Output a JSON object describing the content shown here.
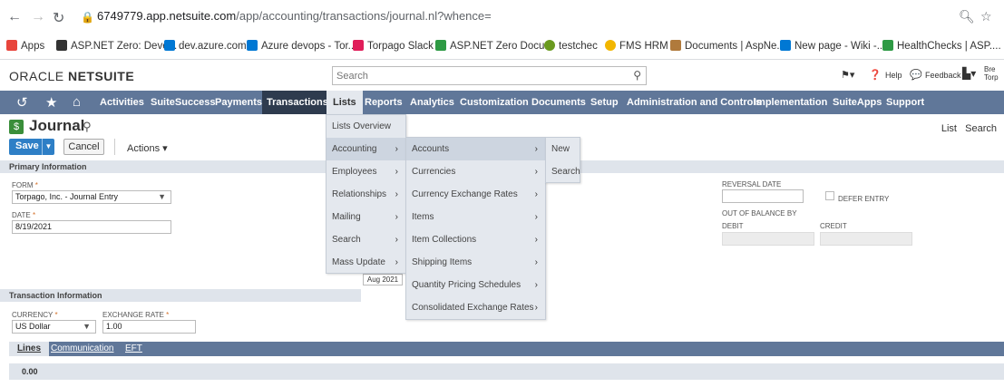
{
  "browser": {
    "url_host": "6749779.app.netsuite.com",
    "url_path": "/app/accounting/transactions/journal.nl?whence="
  },
  "bookmarks": [
    {
      "label": "Apps",
      "color": "#e8453c"
    },
    {
      "label": "ASP.NET Zero: Deve...",
      "color": "#333333"
    },
    {
      "label": "dev.azure.com",
      "color": "#0078d4"
    },
    {
      "label": "Azure devops - Tor...",
      "color": "#0078d4"
    },
    {
      "label": "Torpago Slack",
      "color": "#e01e5a"
    },
    {
      "label": "ASP.NET Zero Docu...",
      "color": "#2e9a44"
    },
    {
      "label": "testchec",
      "color": "#6a9a1f"
    },
    {
      "label": "FMS HRM",
      "color": "#f2b600"
    },
    {
      "label": "Documents | AspNe...",
      "color": "#b07a3c"
    },
    {
      "label": "New page - Wiki -...",
      "color": "#0078d4"
    },
    {
      "label": "HealthChecks | ASP....",
      "color": "#2e9a44"
    }
  ],
  "header": {
    "logo_light": "ORACLE ",
    "logo_bold": "NETSUITE",
    "search_placeholder": "Search",
    "help": "Help",
    "feedback": "Feedback",
    "user_partial": "Bre",
    "user_partial_2": "Torp"
  },
  "menubar": {
    "items": [
      "Activities",
      "SuiteSuccess",
      "Payments",
      "Transactions",
      "Lists",
      "Reports",
      "Analytics",
      "Customization",
      "Documents",
      "Setup",
      "Administration and Controls",
      "Implementation",
      "SuiteApps",
      "Support"
    ]
  },
  "page": {
    "title": "Journal",
    "list_link": "List",
    "search_link": "Search",
    "save": "Save",
    "cancel": "Cancel",
    "actions": "Actions ▾"
  },
  "primary": {
    "header": "Primary Information",
    "form_label": "FORM",
    "form_value": "Torpago, Inc. - Journal Entry",
    "date_label": "DATE",
    "date_value": "8/19/2021",
    "reversal_label": "REVERSAL DATE",
    "defer_label": "DEFER ENTRY",
    "oob_label": "OUT OF BALANCE BY",
    "debit_label": "DEBIT",
    "credit_label": "CREDIT"
  },
  "transaction": {
    "header": "Transaction Information",
    "currency_label": "CURRENCY",
    "currency_value": "US Dollar",
    "rate_label": "EXCHANGE RATE",
    "rate_value": "1.00"
  },
  "calendar_chip": "Aug 2021",
  "lists_menu": [
    "Lists Overview",
    "Accounting",
    "Employees",
    "Relationships",
    "Mailing",
    "Search",
    "Mass Update"
  ],
  "accounting_menu": [
    "Accounts",
    "Currencies",
    "Currency Exchange Rates",
    "Items",
    "Item Collections",
    "Shipping Items",
    "Quantity Pricing Schedules",
    "Consolidated Exchange Rates"
  ],
  "accounts_menu": [
    "New",
    "Search"
  ],
  "tabs": [
    "Lines",
    "Communication",
    "EFT"
  ],
  "total": "0.00",
  "colors": {
    "menubar": "#607799",
    "active_menu": "#2e3b4e",
    "save": "#2e7fc6"
  }
}
